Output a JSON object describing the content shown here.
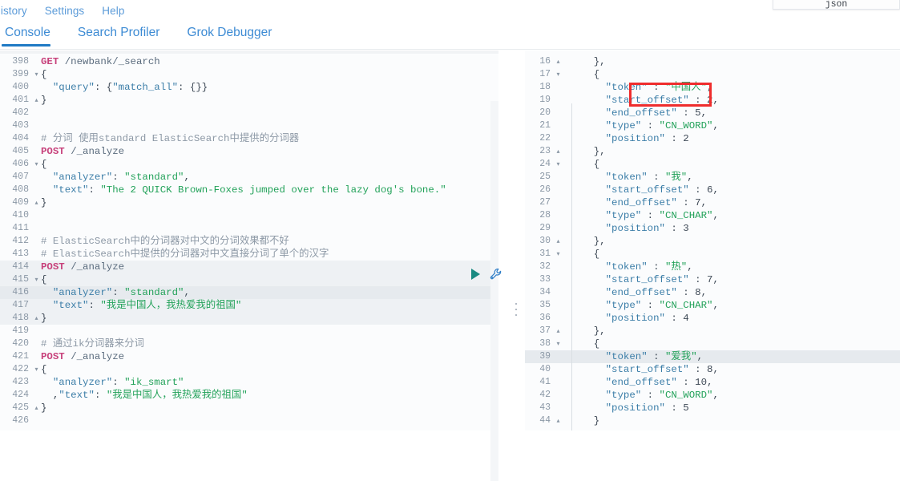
{
  "menubar": {
    "items": [
      {
        "label": "History",
        "clipped": true
      },
      {
        "label": "Settings",
        "clipped": false
      },
      {
        "label": "Help",
        "clipped": false
      }
    ]
  },
  "json_popup": {
    "label": "json"
  },
  "tabs": [
    {
      "label": "Console",
      "active": true
    },
    {
      "label": "Search Profiler",
      "active": false
    },
    {
      "label": "Grok Debugger",
      "active": false
    }
  ],
  "colors": {
    "accent": "#1f7ac4",
    "tab_text": "#3d8bd4",
    "menu_text": "#5b9bd9",
    "method": "#c7417b",
    "string": "#23a25a",
    "key": "#3c7ea8",
    "comment": "#8d99a6",
    "annotation": "#ef2d2d",
    "play": "#1a8a82",
    "highlight_row": "#e6eaee"
  },
  "actions": {
    "play_icon": "play-icon",
    "wrench_icon": "wrench-icon"
  },
  "splitter": {
    "name": "pane-splitter-handle"
  },
  "annotation": {
    "name": "red-highlight-box",
    "target_text": "\"token\" : \"中国人\","
  },
  "request_editor": {
    "name": "console-request-editor",
    "first_line": 398,
    "lines": [
      {
        "n": 398,
        "fold": "",
        "hl": false,
        "block": false,
        "tokens": [
          {
            "c": "t-method",
            "t": "GET"
          },
          {
            "c": "t-plain",
            "t": " "
          },
          {
            "c": "t-url",
            "t": "/newbank/_search"
          }
        ]
      },
      {
        "n": 399,
        "fold": "▾",
        "hl": false,
        "block": false,
        "tokens": [
          {
            "c": "t-punc",
            "t": "{"
          }
        ]
      },
      {
        "n": 400,
        "fold": "",
        "hl": false,
        "block": false,
        "tokens": [
          {
            "c": "t-plain",
            "t": "  "
          },
          {
            "c": "t-key",
            "t": "\"query\""
          },
          {
            "c": "t-punc",
            "t": ": {"
          },
          {
            "c": "t-key",
            "t": "\"match_all\""
          },
          {
            "c": "t-punc",
            "t": ": {}}"
          }
        ]
      },
      {
        "n": 401,
        "fold": "▴",
        "hl": false,
        "block": false,
        "tokens": [
          {
            "c": "t-punc",
            "t": "}"
          }
        ]
      },
      {
        "n": 402,
        "fold": "",
        "hl": false,
        "block": false,
        "tokens": []
      },
      {
        "n": 403,
        "fold": "",
        "hl": false,
        "block": false,
        "tokens": []
      },
      {
        "n": 404,
        "fold": "",
        "hl": false,
        "block": false,
        "tokens": [
          {
            "c": "t-comment",
            "t": "# 分词 使用standard ElasticSearch中提供的分词器"
          }
        ]
      },
      {
        "n": 405,
        "fold": "",
        "hl": false,
        "block": false,
        "tokens": [
          {
            "c": "t-method",
            "t": "POST"
          },
          {
            "c": "t-plain",
            "t": " "
          },
          {
            "c": "t-url",
            "t": "/_analyze"
          }
        ]
      },
      {
        "n": 406,
        "fold": "▾",
        "hl": false,
        "block": false,
        "tokens": [
          {
            "c": "t-punc",
            "t": "{"
          }
        ]
      },
      {
        "n": 407,
        "fold": "",
        "hl": false,
        "block": false,
        "tokens": [
          {
            "c": "t-plain",
            "t": "  "
          },
          {
            "c": "t-key",
            "t": "\"analyzer\""
          },
          {
            "c": "t-punc",
            "t": ": "
          },
          {
            "c": "t-str",
            "t": "\"standard\""
          },
          {
            "c": "t-punc",
            "t": ","
          }
        ]
      },
      {
        "n": 408,
        "fold": "",
        "hl": false,
        "block": false,
        "tokens": [
          {
            "c": "t-plain",
            "t": "  "
          },
          {
            "c": "t-key",
            "t": "\"text\""
          },
          {
            "c": "t-punc",
            "t": ": "
          },
          {
            "c": "t-str",
            "t": "\"The 2 QUICK Brown-Foxes jumped over the lazy dog's bone.\""
          }
        ]
      },
      {
        "n": 409,
        "fold": "▴",
        "hl": false,
        "block": false,
        "tokens": [
          {
            "c": "t-punc",
            "t": "}"
          }
        ]
      },
      {
        "n": 410,
        "fold": "",
        "hl": false,
        "block": false,
        "tokens": []
      },
      {
        "n": 411,
        "fold": "",
        "hl": false,
        "block": false,
        "tokens": []
      },
      {
        "n": 412,
        "fold": "",
        "hl": false,
        "block": false,
        "tokens": [
          {
            "c": "t-comment",
            "t": "# ElasticSearch中的分词器对中文的分词效果都不好"
          }
        ]
      },
      {
        "n": 413,
        "fold": "",
        "hl": false,
        "block": false,
        "tokens": [
          {
            "c": "t-comment",
            "t": "# ElasticSearch中提供的分词器对中文直接分词了单个的汉字"
          }
        ]
      },
      {
        "n": 414,
        "fold": "",
        "hl": false,
        "block": true,
        "tokens": [
          {
            "c": "t-method",
            "t": "POST"
          },
          {
            "c": "t-plain",
            "t": " "
          },
          {
            "c": "t-url",
            "t": "/_analyze"
          }
        ]
      },
      {
        "n": 415,
        "fold": "▾",
        "hl": false,
        "block": true,
        "tokens": [
          {
            "c": "t-punc",
            "t": "{"
          }
        ]
      },
      {
        "n": 416,
        "fold": "",
        "hl": true,
        "block": true,
        "tokens": [
          {
            "c": "t-plain",
            "t": "  "
          },
          {
            "c": "t-key",
            "t": "\"analyzer\""
          },
          {
            "c": "t-punc",
            "t": ": "
          },
          {
            "c": "t-str",
            "t": "\"standard\""
          },
          {
            "c": "t-punc",
            "t": ","
          }
        ]
      },
      {
        "n": 417,
        "fold": "",
        "hl": false,
        "block": true,
        "tokens": [
          {
            "c": "t-plain",
            "t": "  "
          },
          {
            "c": "t-key",
            "t": "\"text\""
          },
          {
            "c": "t-punc",
            "t": ": "
          },
          {
            "c": "t-str",
            "t": "\"我是中国人，我热爱我的祖国\""
          }
        ]
      },
      {
        "n": 418,
        "fold": "▴",
        "hl": false,
        "block": true,
        "tokens": [
          {
            "c": "t-punc",
            "t": "}"
          }
        ]
      },
      {
        "n": 419,
        "fold": "",
        "hl": false,
        "block": false,
        "tokens": []
      },
      {
        "n": 420,
        "fold": "",
        "hl": false,
        "block": false,
        "tokens": [
          {
            "c": "t-comment",
            "t": "# 通过ik分词器来分词"
          }
        ]
      },
      {
        "n": 421,
        "fold": "",
        "hl": false,
        "block": false,
        "tokens": [
          {
            "c": "t-method",
            "t": "POST"
          },
          {
            "c": "t-plain",
            "t": " "
          },
          {
            "c": "t-url",
            "t": "/_analyze"
          }
        ]
      },
      {
        "n": 422,
        "fold": "▾",
        "hl": false,
        "block": false,
        "tokens": [
          {
            "c": "t-punc",
            "t": "{"
          }
        ]
      },
      {
        "n": 423,
        "fold": "",
        "hl": false,
        "block": false,
        "tokens": [
          {
            "c": "t-plain",
            "t": "  "
          },
          {
            "c": "t-key",
            "t": "\"analyzer\""
          },
          {
            "c": "t-punc",
            "t": ": "
          },
          {
            "c": "t-str",
            "t": "\"ik_smart\""
          }
        ]
      },
      {
        "n": 424,
        "fold": "",
        "hl": false,
        "block": false,
        "tokens": [
          {
            "c": "t-plain",
            "t": "  ,"
          },
          {
            "c": "t-key",
            "t": "\"text\""
          },
          {
            "c": "t-punc",
            "t": ": "
          },
          {
            "c": "t-str",
            "t": "\"我是中国人，我热爱我的祖国\""
          }
        ]
      },
      {
        "n": 425,
        "fold": "▴",
        "hl": false,
        "block": false,
        "tokens": [
          {
            "c": "t-punc",
            "t": "}"
          }
        ]
      },
      {
        "n": 426,
        "fold": "",
        "hl": false,
        "block": false,
        "tokens": []
      }
    ]
  },
  "response_editor": {
    "name": "console-response-viewer",
    "first_line": 16,
    "lines": [
      {
        "n": 16,
        "fold": "▴",
        "hl": false,
        "tokens": [
          {
            "c": "t-punc",
            "t": "    },"
          }
        ]
      },
      {
        "n": 17,
        "fold": "▾",
        "hl": false,
        "tokens": [
          {
            "c": "t-punc",
            "t": "    {"
          }
        ]
      },
      {
        "n": 18,
        "fold": "",
        "hl": false,
        "tokens": [
          {
            "c": "t-key",
            "t": "      \"token\""
          },
          {
            "c": "t-punc",
            "t": " : "
          },
          {
            "c": "t-str",
            "t": "\"中国人\""
          },
          {
            "c": "t-punc",
            "t": ","
          }
        ]
      },
      {
        "n": 19,
        "fold": "",
        "hl": false,
        "tokens": [
          {
            "c": "t-key",
            "t": "      \"start_offset\""
          },
          {
            "c": "t-punc",
            "t": " : "
          },
          {
            "c": "t-num",
            "t": "2"
          },
          {
            "c": "t-punc",
            "t": ","
          }
        ]
      },
      {
        "n": 20,
        "fold": "",
        "hl": false,
        "tokens": [
          {
            "c": "t-key",
            "t": "      \"end_offset\""
          },
          {
            "c": "t-punc",
            "t": " : "
          },
          {
            "c": "t-num",
            "t": "5"
          },
          {
            "c": "t-punc",
            "t": ","
          }
        ]
      },
      {
        "n": 21,
        "fold": "",
        "hl": false,
        "tokens": [
          {
            "c": "t-key",
            "t": "      \"type\""
          },
          {
            "c": "t-punc",
            "t": " : "
          },
          {
            "c": "t-str",
            "t": "\"CN_WORD\""
          },
          {
            "c": "t-punc",
            "t": ","
          }
        ]
      },
      {
        "n": 22,
        "fold": "",
        "hl": false,
        "tokens": [
          {
            "c": "t-key",
            "t": "      \"position\""
          },
          {
            "c": "t-punc",
            "t": " : "
          },
          {
            "c": "t-num",
            "t": "2"
          }
        ]
      },
      {
        "n": 23,
        "fold": "▴",
        "hl": false,
        "tokens": [
          {
            "c": "t-punc",
            "t": "    },"
          }
        ]
      },
      {
        "n": 24,
        "fold": "▾",
        "hl": false,
        "tokens": [
          {
            "c": "t-punc",
            "t": "    {"
          }
        ]
      },
      {
        "n": 25,
        "fold": "",
        "hl": false,
        "tokens": [
          {
            "c": "t-key",
            "t": "      \"token\""
          },
          {
            "c": "t-punc",
            "t": " : "
          },
          {
            "c": "t-str",
            "t": "\"我\""
          },
          {
            "c": "t-punc",
            "t": ","
          }
        ]
      },
      {
        "n": 26,
        "fold": "",
        "hl": false,
        "tokens": [
          {
            "c": "t-key",
            "t": "      \"start_offset\""
          },
          {
            "c": "t-punc",
            "t": " : "
          },
          {
            "c": "t-num",
            "t": "6"
          },
          {
            "c": "t-punc",
            "t": ","
          }
        ]
      },
      {
        "n": 27,
        "fold": "",
        "hl": false,
        "tokens": [
          {
            "c": "t-key",
            "t": "      \"end_offset\""
          },
          {
            "c": "t-punc",
            "t": " : "
          },
          {
            "c": "t-num",
            "t": "7"
          },
          {
            "c": "t-punc",
            "t": ","
          }
        ]
      },
      {
        "n": 28,
        "fold": "",
        "hl": false,
        "tokens": [
          {
            "c": "t-key",
            "t": "      \"type\""
          },
          {
            "c": "t-punc",
            "t": " : "
          },
          {
            "c": "t-str",
            "t": "\"CN_CHAR\""
          },
          {
            "c": "t-punc",
            "t": ","
          }
        ]
      },
      {
        "n": 29,
        "fold": "",
        "hl": false,
        "tokens": [
          {
            "c": "t-key",
            "t": "      \"position\""
          },
          {
            "c": "t-punc",
            "t": " : "
          },
          {
            "c": "t-num",
            "t": "3"
          }
        ]
      },
      {
        "n": 30,
        "fold": "▴",
        "hl": false,
        "tokens": [
          {
            "c": "t-punc",
            "t": "    },"
          }
        ]
      },
      {
        "n": 31,
        "fold": "▾",
        "hl": false,
        "tokens": [
          {
            "c": "t-punc",
            "t": "    {"
          }
        ]
      },
      {
        "n": 32,
        "fold": "",
        "hl": false,
        "tokens": [
          {
            "c": "t-key",
            "t": "      \"token\""
          },
          {
            "c": "t-punc",
            "t": " : "
          },
          {
            "c": "t-str",
            "t": "\"热\""
          },
          {
            "c": "t-punc",
            "t": ","
          }
        ]
      },
      {
        "n": 33,
        "fold": "",
        "hl": false,
        "tokens": [
          {
            "c": "t-key",
            "t": "      \"start_offset\""
          },
          {
            "c": "t-punc",
            "t": " : "
          },
          {
            "c": "t-num",
            "t": "7"
          },
          {
            "c": "t-punc",
            "t": ","
          }
        ]
      },
      {
        "n": 34,
        "fold": "",
        "hl": false,
        "tokens": [
          {
            "c": "t-key",
            "t": "      \"end_offset\""
          },
          {
            "c": "t-punc",
            "t": " : "
          },
          {
            "c": "t-num",
            "t": "8"
          },
          {
            "c": "t-punc",
            "t": ","
          }
        ]
      },
      {
        "n": 35,
        "fold": "",
        "hl": false,
        "tokens": [
          {
            "c": "t-key",
            "t": "      \"type\""
          },
          {
            "c": "t-punc",
            "t": " : "
          },
          {
            "c": "t-str",
            "t": "\"CN_CHAR\""
          },
          {
            "c": "t-punc",
            "t": ","
          }
        ]
      },
      {
        "n": 36,
        "fold": "",
        "hl": false,
        "tokens": [
          {
            "c": "t-key",
            "t": "      \"position\""
          },
          {
            "c": "t-punc",
            "t": " : "
          },
          {
            "c": "t-num",
            "t": "4"
          }
        ]
      },
      {
        "n": 37,
        "fold": "▴",
        "hl": false,
        "tokens": [
          {
            "c": "t-punc",
            "t": "    },"
          }
        ]
      },
      {
        "n": 38,
        "fold": "▾",
        "hl": false,
        "tokens": [
          {
            "c": "t-punc",
            "t": "    {"
          }
        ]
      },
      {
        "n": 39,
        "fold": "",
        "hl": true,
        "tokens": [
          {
            "c": "t-key",
            "t": "      \"token\""
          },
          {
            "c": "t-punc",
            "t": " : "
          },
          {
            "c": "t-str",
            "t": "\"爱我\""
          },
          {
            "c": "t-punc",
            "t": ","
          }
        ]
      },
      {
        "n": 40,
        "fold": "",
        "hl": false,
        "tokens": [
          {
            "c": "t-key",
            "t": "      \"start_offset\""
          },
          {
            "c": "t-punc",
            "t": " : "
          },
          {
            "c": "t-num",
            "t": "8"
          },
          {
            "c": "t-punc",
            "t": ","
          }
        ]
      },
      {
        "n": 41,
        "fold": "",
        "hl": false,
        "tokens": [
          {
            "c": "t-key",
            "t": "      \"end_offset\""
          },
          {
            "c": "t-punc",
            "t": " : "
          },
          {
            "c": "t-num",
            "t": "10"
          },
          {
            "c": "t-punc",
            "t": ","
          }
        ]
      },
      {
        "n": 42,
        "fold": "",
        "hl": false,
        "tokens": [
          {
            "c": "t-key",
            "t": "      \"type\""
          },
          {
            "c": "t-punc",
            "t": " : "
          },
          {
            "c": "t-str",
            "t": "\"CN_WORD\""
          },
          {
            "c": "t-punc",
            "t": ","
          }
        ]
      },
      {
        "n": 43,
        "fold": "",
        "hl": false,
        "tokens": [
          {
            "c": "t-key",
            "t": "      \"position\""
          },
          {
            "c": "t-punc",
            "t": " : "
          },
          {
            "c": "t-num",
            "t": "5"
          }
        ]
      },
      {
        "n": 44,
        "fold": "▴",
        "hl": false,
        "tokens": [
          {
            "c": "t-punc",
            "t": "    }"
          }
        ]
      }
    ]
  }
}
